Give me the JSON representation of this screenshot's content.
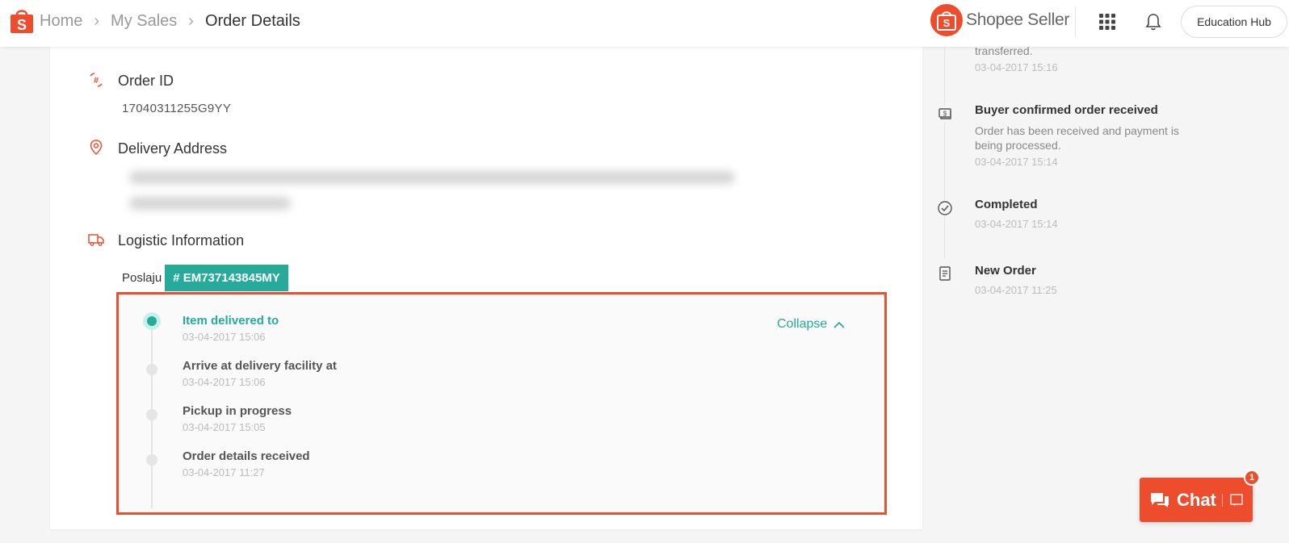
{
  "header": {
    "breadcrumb": [
      "Home",
      "My Sales",
      "Order Details"
    ],
    "brand": "Shopee Seller",
    "education_hub": "Education Hub"
  },
  "order": {
    "order_id_label": "Order ID",
    "order_id": "17040311255G9YY",
    "address_label": "Delivery Address",
    "logistics_label": "Logistic Information",
    "carrier": "Poslaju",
    "tracking_number": "# EM737143845MY"
  },
  "tracking": {
    "collapse_label": "Collapse",
    "events": [
      {
        "title": "Item delivered to",
        "time": "03-04-2017 15:06"
      },
      {
        "title": "Arrive at delivery facility at",
        "time": "03-04-2017 15:06"
      },
      {
        "title": "Pickup in progress",
        "time": "03-04-2017 15:05"
      },
      {
        "title": "Order details received",
        "time": "03-04-2017 11:27"
      }
    ]
  },
  "status_timeline": {
    "partial_top": {
      "desc": "transferred.",
      "time": "03-04-2017 15:16"
    },
    "events": [
      {
        "title": "Buyer confirmed order received",
        "desc": "Order has been received and payment is being processed.",
        "time": "03-04-2017 15:14",
        "icon": "money-icon"
      },
      {
        "title": "Completed",
        "time": "03-04-2017 15:14",
        "icon": "check-circle-icon"
      },
      {
        "title": "New Order",
        "time": "03-04-2017 11:25",
        "icon": "document-icon"
      }
    ]
  },
  "chat": {
    "label": "Chat",
    "badge": "1"
  },
  "colors": {
    "brand": "#ee4d2d",
    "teal": "#26aa99",
    "highlight": "#e8502e"
  }
}
